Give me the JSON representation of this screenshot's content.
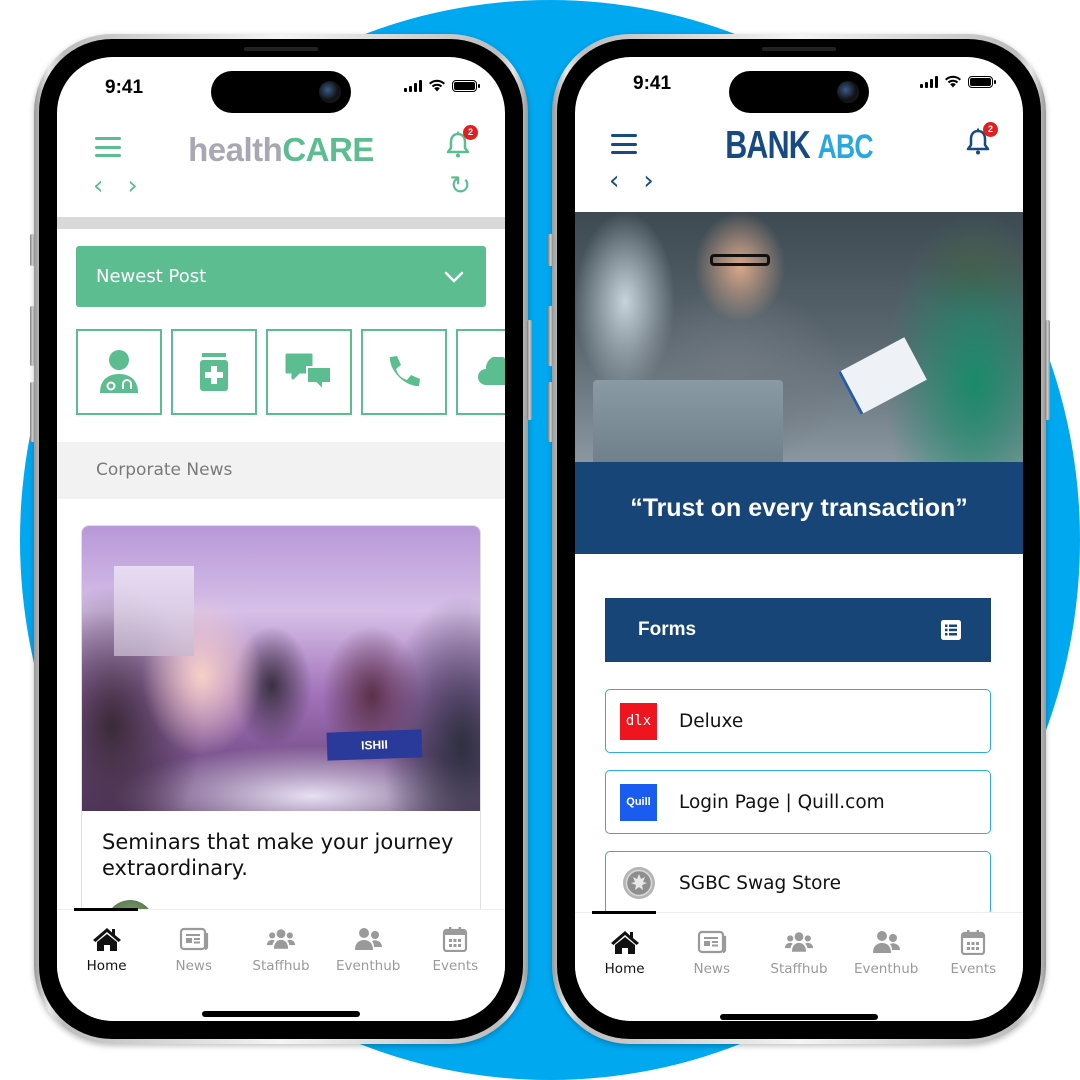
{
  "colors": {
    "background_circle": "#00a8f0",
    "health_green": "#5bbd90",
    "health_gray": "#a9a8b2",
    "bank_navy": "#174578",
    "bank_light_blue": "#29a8e0",
    "badge_red": "#e02020"
  },
  "phones": {
    "health": {
      "status_bar": {
        "time": "9:41"
      },
      "header": {
        "logo_part1": "health",
        "logo_part2": "CARE",
        "notification_count": "2",
        "back_icon": "chevron-left",
        "forward_icon": "chevron-right",
        "menu_icon": "hamburger",
        "refresh_icon": "refresh"
      },
      "dropdown": {
        "label": "Newest Post",
        "icon": "chevron-down"
      },
      "quick_tiles": [
        {
          "icon": "doctor-icon"
        },
        {
          "icon": "medicine-bottle-icon"
        },
        {
          "icon": "chat-bubbles-icon"
        },
        {
          "icon": "phone-icon"
        },
        {
          "icon": "cloud-icon"
        }
      ],
      "section_title": "Corporate News",
      "news_card": {
        "image_nameplate": "ISHII",
        "title": "Seminars that make your  journey extraordinary."
      },
      "tabbar": {
        "tabs": [
          {
            "label": "Home",
            "icon": "home",
            "active": true
          },
          {
            "label": "News",
            "icon": "newspaper",
            "active": false
          },
          {
            "label": "Staffhub",
            "icon": "users",
            "active": false
          },
          {
            "label": "Eventhub",
            "icon": "user-friends",
            "active": false
          },
          {
            "label": "Events",
            "icon": "calendar",
            "active": false
          }
        ]
      }
    },
    "bank": {
      "status_bar": {
        "time": "9:41"
      },
      "header": {
        "logo_part1": "BANK",
        "logo_part2": "ABC",
        "notification_count": "2",
        "back_icon": "chevron-left",
        "forward_icon": "chevron-right",
        "menu_icon": "hamburger"
      },
      "slogan": "“Trust on every transaction”",
      "forms_section": {
        "title": "Forms",
        "icon": "list-alt"
      },
      "form_items": [
        {
          "logo_text": "dlx",
          "logo_color": "#f0141e",
          "name": "Deluxe"
        },
        {
          "logo_text": "Quill",
          "logo_color": "#1a5cf0",
          "name": "Login Page | Quill.com"
        },
        {
          "logo_text": "",
          "logo_color": "#9a9a9a",
          "name": "SGBC Swag Store"
        }
      ],
      "tabbar": {
        "tabs": [
          {
            "label": "Home",
            "icon": "home",
            "active": true
          },
          {
            "label": "News",
            "icon": "newspaper",
            "active": false
          },
          {
            "label": "Staffhub",
            "icon": "users",
            "active": false
          },
          {
            "label": "Eventhub",
            "icon": "user-friends",
            "active": false
          },
          {
            "label": "Events",
            "icon": "calendar",
            "active": false
          }
        ]
      }
    }
  }
}
